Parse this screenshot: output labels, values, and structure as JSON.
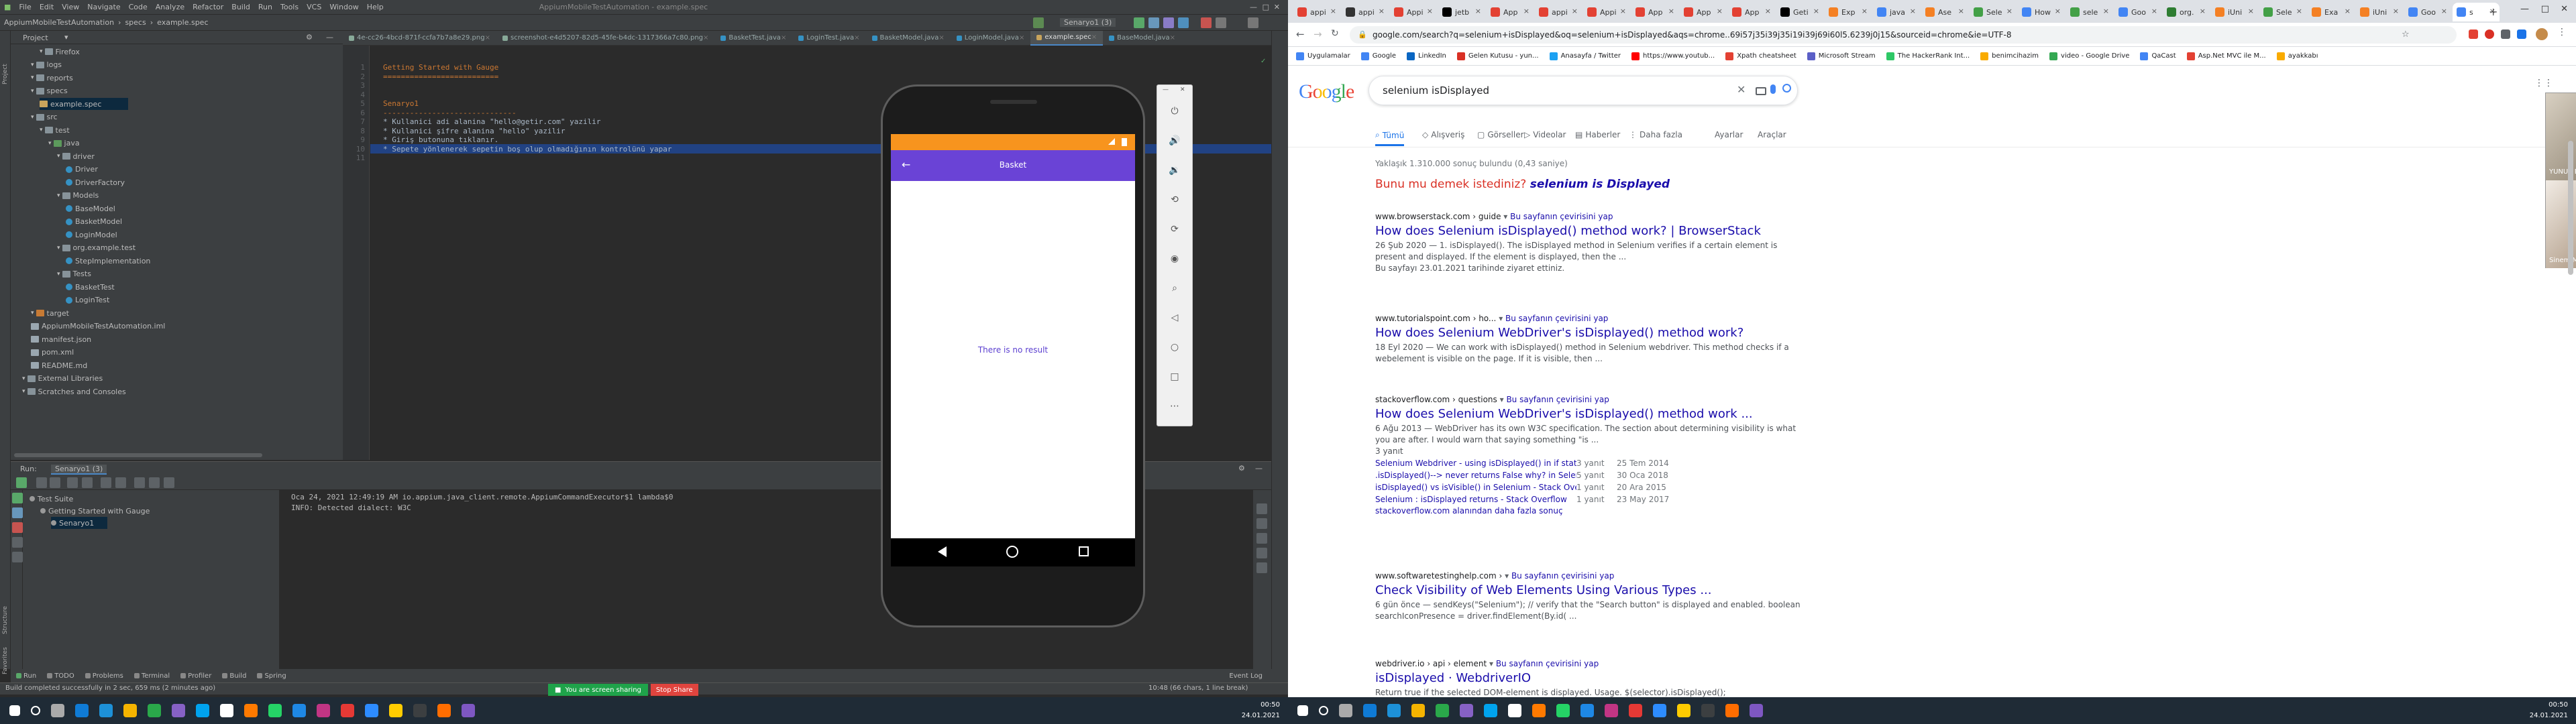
{
  "ide": {
    "menu": [
      "File",
      "Edit",
      "View",
      "Navigate",
      "Code",
      "Analyze",
      "Refactor",
      "Build",
      "Run",
      "Tools",
      "VCS",
      "Window",
      "Help"
    ],
    "window_title": "AppiumMobileTestAutomation - example.spec",
    "breadcrumb": [
      "AppiumMobileTestAutomation",
      "specs",
      "example.spec"
    ],
    "run_config": "Senaryo1 (3)",
    "project_label": "Project",
    "tree": [
      {
        "label": "Firefox",
        "indent": 3,
        "icon": "fold"
      },
      {
        "label": "logs",
        "indent": 2,
        "icon": "fold"
      },
      {
        "label": "reports",
        "indent": 2,
        "icon": "fold"
      },
      {
        "label": "specs",
        "indent": 2,
        "icon": "fold"
      },
      {
        "label": "example.spec",
        "indent": 3,
        "icon": "file-spec",
        "selected": true
      },
      {
        "label": "src",
        "indent": 2,
        "icon": "fold"
      },
      {
        "label": "test",
        "indent": 3,
        "icon": "fold"
      },
      {
        "label": "java",
        "indent": 4,
        "icon": "fold-test"
      },
      {
        "label": "driver",
        "indent": 5,
        "icon": "fold"
      },
      {
        "label": "Driver",
        "indent": 6,
        "icon": "file-java"
      },
      {
        "label": "DriverFactory",
        "indent": 6,
        "icon": "file-java"
      },
      {
        "label": "Models",
        "indent": 5,
        "icon": "fold"
      },
      {
        "label": "BaseModel",
        "indent": 6,
        "icon": "file-java"
      },
      {
        "label": "BasketModel",
        "indent": 6,
        "icon": "file-java"
      },
      {
        "label": "LoginModel",
        "indent": 6,
        "icon": "file-java"
      },
      {
        "label": "org.example.test",
        "indent": 5,
        "icon": "fold"
      },
      {
        "label": "StepImplementation",
        "indent": 6,
        "icon": "file-java"
      },
      {
        "label": "Tests",
        "indent": 5,
        "icon": "fold"
      },
      {
        "label": "BasketTest",
        "indent": 6,
        "icon": "file-java"
      },
      {
        "label": "LoginTest",
        "indent": 6,
        "icon": "file-java"
      },
      {
        "label": "target",
        "indent": 2,
        "icon": "fold-tgt"
      },
      {
        "label": "AppiumMobileTestAutomation.iml",
        "indent": 2,
        "icon": "file-doc"
      },
      {
        "label": "manifest.json",
        "indent": 2,
        "icon": "file-doc"
      },
      {
        "label": "pom.xml",
        "indent": 2,
        "icon": "file-doc"
      },
      {
        "label": "README.md",
        "indent": 2,
        "icon": "file-doc"
      },
      {
        "label": "External Libraries",
        "indent": 1,
        "icon": "fold"
      },
      {
        "label": "Scratches and Consoles",
        "indent": 1,
        "icon": "fold"
      }
    ],
    "editor_tabs": [
      "4e-cc26-4bcd-871f-ccfa7b7a8e29.png",
      "screenshot-e4d5207-82d5-45fe-b4dc-1317366a7c80.png",
      "BasketTest.java",
      "LoginTest.java",
      "BasketModel.java",
      "LoginModel.java",
      "example.spec",
      "BaseModel.java"
    ],
    "active_tab": 6,
    "code_lines": [
      {
        "n": "1",
        "text": "Getting Started with Gauge",
        "color": "#cc7832"
      },
      {
        "n": "2",
        "text": "==========================",
        "color": "#cc7832"
      },
      {
        "n": "3",
        "text": "",
        "color": "#a9b7c6"
      },
      {
        "n": "4",
        "text": "",
        "color": "#a9b7c6"
      },
      {
        "n": "5",
        "text": "Senaryo1",
        "color": "#cc7832"
      },
      {
        "n": "6",
        "text": "------------------------------",
        "color": "#cc7832"
      },
      {
        "n": "7",
        "text": "* Kullanici adi alanina \"hello@getir.com\" yazilir",
        "color": "#a9b7c6"
      },
      {
        "n": "8",
        "text": "* Kullanici şifre alanina \"hello\" yazilir",
        "color": "#a9b7c6"
      },
      {
        "n": "9",
        "text": "* Giriş butonuna tıklanır.",
        "color": "#a9b7c6"
      },
      {
        "n": "10",
        "text": "* Sepete yönlenerek sepetin boş olup olmadığının kontrolünü yapar",
        "color": "#a9b7c6",
        "highlight": true
      },
      {
        "n": "11",
        "text": "",
        "color": "#a9b7c6"
      }
    ],
    "run": {
      "tab_label": "Run:",
      "config": "Senaryo1 (3)",
      "tree": [
        "Test Suite",
        "Getting Started with Gauge",
        "Senaryo1"
      ],
      "console": [
        "Oca 24, 2021 12:49:19 AM io.appium.java_client.remote.AppiumCommandExecutor$1 lambda$0",
        "INFO: Detected dialect: W3C"
      ]
    },
    "bottom_tabs": [
      "Run",
      "TODO",
      "Problems",
      "Terminal",
      "Profiler",
      "Build",
      "Spring"
    ],
    "event_log": "Event Log",
    "status_left": "Build completed successfully in 2 sec, 659 ms (2 minutes ago)",
    "status_right": "10:48 (66 chars, 1 line break)",
    "left_strip": [
      "Project",
      "Structure",
      "Favorites"
    ]
  },
  "emulator": {
    "screen_title": "Basket",
    "empty_message": "There is no result",
    "controls": [
      "power-icon",
      "volume-up-icon",
      "volume-down-icon",
      "rotate-left-icon",
      "rotate-right-icon",
      "camera-icon",
      "zoom-icon",
      "back-icon",
      "home-icon",
      "overview-icon",
      "more-icon"
    ]
  },
  "share_bar": {
    "text": "You are screen sharing",
    "stop": "Stop Share"
  },
  "taskbar_clock": {
    "time": "00:50",
    "date": "24.01.2021"
  },
  "chrome": {
    "tabs": [
      "appi",
      "appi",
      "Appi",
      "jetb",
      "App",
      "appi",
      "Appi",
      "App",
      "App",
      "App",
      "Geti",
      "Exp",
      "java",
      "Ase",
      "Sele",
      "How",
      "sele",
      "Goo",
      "org.",
      "iUni",
      "Sele",
      "Exa",
      "iUni",
      "Goo",
      "s"
    ],
    "active_tab": 24,
    "url": "google.com/search?q=selenium+isDisplayed&oq=selenium+isDisplayed&aqs=chrome..69i57j35i39j35i19i39j69i60l5.6239j0j15&sourceid=chrome&ie=UTF-8",
    "bookmarks": [
      "Uygulamalar",
      "Google",
      "LinkedIn",
      "Gelen Kutusu - yun...",
      "Anasayfa / Twitter",
      "https://www.youtub...",
      "Xpath cheatsheet",
      "Microsoft Stream",
      "The HackerRank Int...",
      "benimcihazim",
      "video - Google Drive",
      "QaCast",
      "Asp.Net MVC ile M...",
      "ayakkabı"
    ]
  },
  "google": {
    "logo": "Google",
    "query": "selenium isDisplayed",
    "tabs": [
      "Tümü",
      "Alışveriş",
      "Görseller",
      "Videolar",
      "Haberler",
      "Daha fazla",
      "Ayarlar",
      "Araçlar"
    ],
    "stats": "Yaklaşık 1.310.000 sonuç bulundu (0,43 saniye)",
    "didyoumean_prefix": "Bunu mu demek istediniz?",
    "didyoumean_query": "selenium is Displayed",
    "results": [
      {
        "url": "www.browserstack.com › guide",
        "translate": "Bu sayfanın çevirisini yap",
        "title": "How does Selenium isDisplayed() method work? | BrowserStack",
        "snippet": "26 Şub 2020 — 1. isDisplayed(). The isDisplayed method in Selenium verifies if a certain element is present and displayed. If the element is displayed, then the ...",
        "visited": "Bu sayfayı 23.01.2021 tarihinde ziyaret ettiniz."
      },
      {
        "url": "www.tutorialspoint.com › ho...",
        "translate": "Bu sayfanın çevirisini yap",
        "title": "How does Selenium WebDriver's isDisplayed() method work?",
        "snippet": "18 Eyl 2020 — We can work with isDisplayed() method in Selenium webdriver. This method checks if a webelement is visible on the page. If it is visible, then ..."
      },
      {
        "url": "stackoverflow.com › questions",
        "translate": "Bu sayfanın çevirisini yap",
        "title": "How does Selenium WebDriver's isDisplayed() method work ...",
        "snippet": "6 Ağu 2013 — WebDriver has its own W3C specification. The section about determining visibility is what you are after. I would warn that saying something \"is ...",
        "count": "3 yanıt",
        "sublinks": [
          {
            "text": "Selenium Webdriver - using isDisplayed() in if statement ...",
            "answers": "3 yanıt",
            "date": "25 Tem 2014"
          },
          {
            "text": ".isDisplayed()--> never returns False why? in Selenium ...",
            "answers": "5 yanıt",
            "date": "30 Oca 2018"
          },
          {
            "text": "isDisplayed() vs isVisible() in Selenium - Stack Overflow",
            "answers": "1 yanıt",
            "date": "20 Ara 2015"
          },
          {
            "text": "Selenium : isDisplayed returns - Stack Overflow",
            "answers": "1 yanıt",
            "date": "23 May 2017"
          }
        ],
        "more": "stackoverflow.com alanından daha fazla sonuç"
      },
      {
        "url": "www.softwaretestinghelp.com ›",
        "translate": "Bu sayfanın çevirisini yap",
        "title": "Check Visibility of Web Elements Using Various Types ...",
        "snippet": "6 gün önce — sendKeys(\"Selenium\"); // verify that the \"Search button\" is displayed and enabled. boolean searchIconPresence = driver.findElement(By.id( ..."
      },
      {
        "url": "webdriver.io › api › element",
        "translate": "Bu sayfanın çevirisini yap",
        "title": "isDisplayed · WebdriverIO",
        "snippet": "Return true if the selected DOM-element is displayed. Usage. $(selector).isDisplayed();"
      }
    ],
    "video_names": [
      "YUNUS EMRE KILIÇ",
      "Sinem Merve Yılmaz"
    ]
  }
}
